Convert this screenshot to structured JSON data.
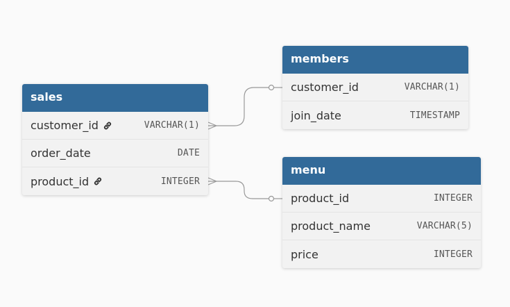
{
  "tables": {
    "sales": {
      "title": "sales",
      "columns": [
        {
          "name": "customer_id",
          "type": "VARCHAR(1)",
          "icon": "link-icon"
        },
        {
          "name": "order_date",
          "type": "DATE"
        },
        {
          "name": "product_id",
          "type": "INTEGER",
          "icon": "link-icon"
        }
      ]
    },
    "members": {
      "title": "members",
      "columns": [
        {
          "name": "customer_id",
          "type": "VARCHAR(1)"
        },
        {
          "name": "join_date",
          "type": "TIMESTAMP"
        }
      ]
    },
    "menu": {
      "title": "menu",
      "columns": [
        {
          "name": "product_id",
          "type": "INTEGER"
        },
        {
          "name": "product_name",
          "type": "VARCHAR(5)"
        },
        {
          "name": "price",
          "type": "INTEGER"
        }
      ]
    }
  },
  "relationships": [
    {
      "from": "sales.customer_id",
      "to": "members.customer_id",
      "from_end": "many",
      "to_end": "one"
    },
    {
      "from": "sales.product_id",
      "to": "menu.product_id",
      "from_end": "many",
      "to_end": "one"
    }
  ],
  "colors": {
    "header": "#326a99",
    "header_text": "#ffffff",
    "body": "#f2f2f2",
    "connector": "#999999"
  }
}
